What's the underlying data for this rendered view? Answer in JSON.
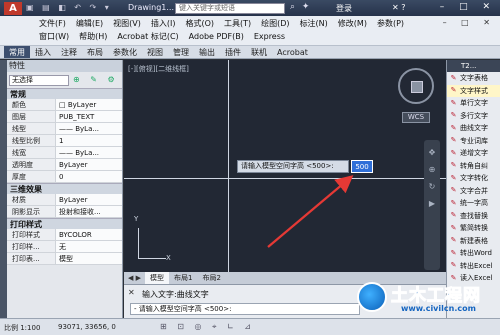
{
  "title_bar": {
    "doc_title": "Drawing1...",
    "search_placeholder": "键入关键字或短语",
    "login": "登录",
    "window_buttons": "– □ ✕"
  },
  "menu": {
    "row1": [
      "文件(F)",
      "编辑(E)",
      "视图(V)",
      "插入(I)",
      "格式(O)",
      "工具(T)",
      "绘图(D)",
      "标注(N)",
      "修改(M)",
      "参数(P)"
    ],
    "row2": [
      "窗口(W)",
      "帮助(H)",
      "Acrobat 标记(C)",
      "Adobe PDF(B)",
      "Express"
    ]
  },
  "ribbon_tabs": [
    "常用",
    "插入",
    "注释",
    "布局",
    "参数化",
    "视图",
    "管理",
    "输出",
    "插件",
    "联机",
    "Acrobat"
  ],
  "properties": {
    "title": "特性",
    "selection": "无选择",
    "sections": {
      "general": "常规",
      "3d": "三维效果",
      "print": "打印样式"
    },
    "general_rows": [
      {
        "k": "颜色",
        "v": "□ ByLayer"
      },
      {
        "k": "图层",
        "v": "PUB_TEXT"
      },
      {
        "k": "线型",
        "v": "—— ByLa..."
      },
      {
        "k": "线型比例",
        "v": "1"
      },
      {
        "k": "线宽",
        "v": "—— ByLa..."
      },
      {
        "k": "透明度",
        "v": "ByLayer"
      },
      {
        "k": "厚度",
        "v": "0"
      }
    ],
    "three_d_rows": [
      {
        "k": "材质",
        "v": "ByLayer"
      },
      {
        "k": "阴影显示",
        "v": "投射和接收..."
      }
    ],
    "print_rows": [
      {
        "k": "打印样式",
        "v": "BYCOLOR"
      },
      {
        "k": "打印样...",
        "v": "无"
      },
      {
        "k": "打印表...",
        "v": "模型"
      }
    ]
  },
  "canvas": {
    "viewport_label": "[-][俯视][二维线框]",
    "wcs": "WCS",
    "prompt_text": "请输入模型空间字高 <500>:",
    "prompt_value": "500",
    "ucs_y": "Y",
    "ucs_x": "X"
  },
  "layout_tabs": [
    "模型",
    "布局1",
    "布局2"
  ],
  "command": {
    "line1": "输入文字:曲线文字",
    "line2": "- 请输入模型空间字高 <500>:"
  },
  "status": {
    "scale": "比例 1:100",
    "coords": "93071, 33656, 0"
  },
  "tool_palette": {
    "header": "T2...",
    "items": [
      {
        "label": "文字表格",
        "selected": false
      },
      {
        "label": "文字样式",
        "selected": true
      },
      {
        "label": "单行文字",
        "selected": false
      },
      {
        "label": "多行文字",
        "selected": false
      },
      {
        "label": "曲线文字",
        "selected": false
      },
      {
        "label": "专业词库",
        "selected": false
      },
      {
        "label": "递增文字",
        "selected": false
      },
      {
        "label": "转角自纠",
        "selected": false
      },
      {
        "label": "文字转化",
        "selected": false
      },
      {
        "label": "文字合并",
        "selected": false
      },
      {
        "label": "统一字高",
        "selected": false
      },
      {
        "label": "查找替换",
        "selected": false
      },
      {
        "label": "繁简转换",
        "selected": false
      },
      {
        "label": "新建表格",
        "selected": false
      },
      {
        "label": "转出Word",
        "selected": false
      },
      {
        "label": "转出Excel",
        "selected": false
      },
      {
        "label": "读入Excel",
        "selected": false
      }
    ]
  },
  "watermark": {
    "brand": "土木工程网",
    "url": "www.civilcn.com"
  },
  "colors": {
    "canvas_bg": "#222834",
    "accent": "#2f6fd8",
    "arrow": "#e53935"
  }
}
